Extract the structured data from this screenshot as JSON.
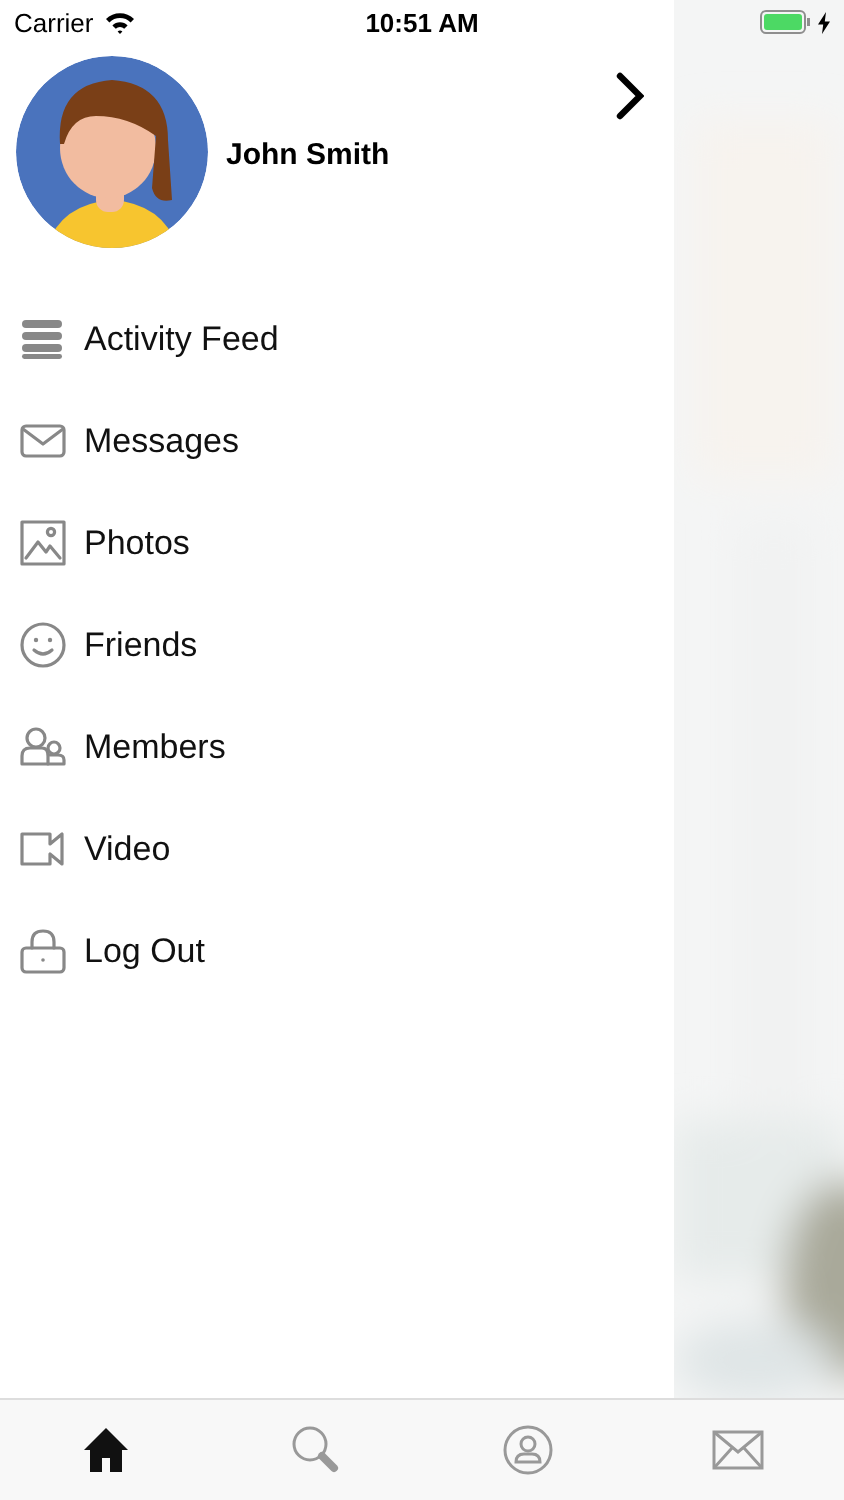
{
  "status_bar": {
    "carrier": "Carrier",
    "time": "10:51 AM"
  },
  "profile": {
    "name": "John Smith"
  },
  "menu": [
    {
      "kind": "feed",
      "label": "Activity Feed"
    },
    {
      "kind": "mail",
      "label": "Messages"
    },
    {
      "label": "Photos"
    },
    {
      "kind": "smile",
      "label": "Friends"
    },
    {
      "kind": "members",
      "label": "Members"
    },
    {
      "kind": "video",
      "label": "Video"
    },
    {
      "kind": "lock",
      "label": "Log Out"
    }
  ],
  "tab_bar": [
    {
      "kind": "home",
      "selected": true
    },
    {
      "kind": "search",
      "selected": false
    },
    {
      "kind": "profile",
      "selected": false
    },
    {
      "kind": "mail",
      "selected": false
    }
  ]
}
